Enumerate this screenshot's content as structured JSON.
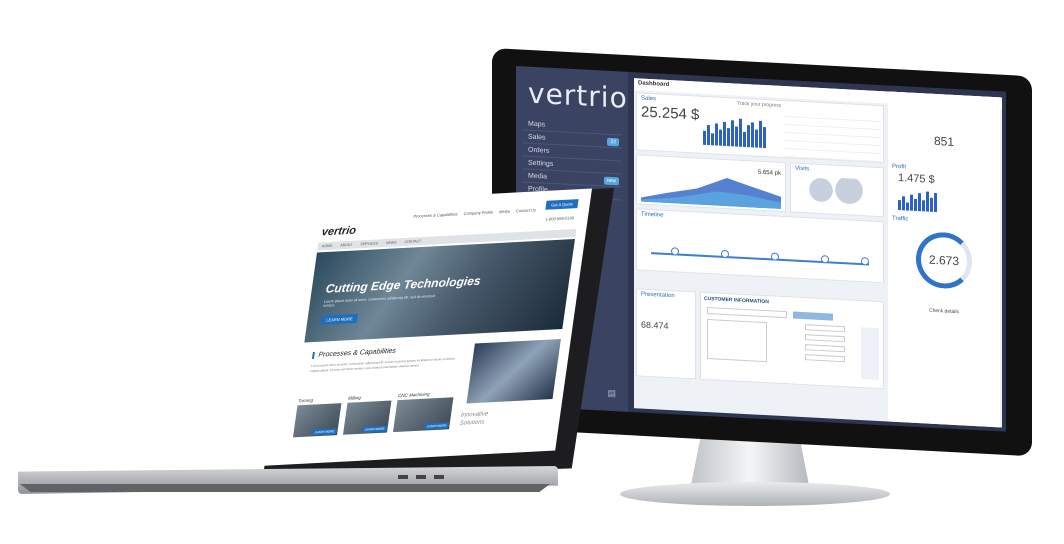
{
  "monitor": {
    "logo": "vertrio",
    "nav": [
      {
        "label": "Maps",
        "badge": ""
      },
      {
        "label": "Sales",
        "badge": "22"
      },
      {
        "label": "Orders",
        "badge": ""
      },
      {
        "label": "Settings",
        "badge": ""
      },
      {
        "label": "Media",
        "badge": "new"
      },
      {
        "label": "Profile",
        "badge": ""
      }
    ],
    "dashboard_title": "Dashboard",
    "sales_title": "Sales",
    "sales_value": "25.254 $",
    "track_progress": "Track your progress",
    "visits_value": "5.654 pk",
    "visits_title": "Visits",
    "timeline_title": "Timeline",
    "presentation_title": "Presentation",
    "presentation_value": "68.474",
    "customer_info_title": "CUSTOMER INFORMATION",
    "right": {
      "social_value": "851",
      "profit_title": "Profit",
      "profit_value": "1.475 $",
      "traffic_title": "Traffic",
      "traffic_value": "2.673",
      "footer_label": "Check details"
    }
  },
  "laptop": {
    "logo": "vertrio",
    "top_nav": [
      "Processes & Capabilities",
      "Company Profile",
      "Media",
      "Contact Us"
    ],
    "cta": "Get A Quote",
    "phone": "1-800-555-0199",
    "menu": [
      "HOME",
      "ABOUT",
      "SERVICES",
      "NEWS",
      "CONTACT"
    ],
    "hero_title": "Cutting Edge Technologies",
    "hero_sub": "Lorem ipsum dolor sit amet, consectetur adipiscing elit, sed do eiusmod tempor.",
    "hero_button": "LEARN MORE",
    "section_title": "Processes & Capabilities",
    "section_text": "Lorem ipsum dolor sit amet, consectetur adipiscing elit, sed do eiusmod tempor incididunt ut labore et dolore magna aliqua. Ut enim ad minim veniam, quis nostrud exercitation ullamco laboris.",
    "capabilities": [
      {
        "label": "Turning",
        "button": "LEARN MORE"
      },
      {
        "label": "Milling",
        "button": "LEARN MORE"
      },
      {
        "label": "CNC Machining",
        "button": "LEARN MORE"
      }
    ],
    "innovative": "Innovative\nSolutions"
  }
}
